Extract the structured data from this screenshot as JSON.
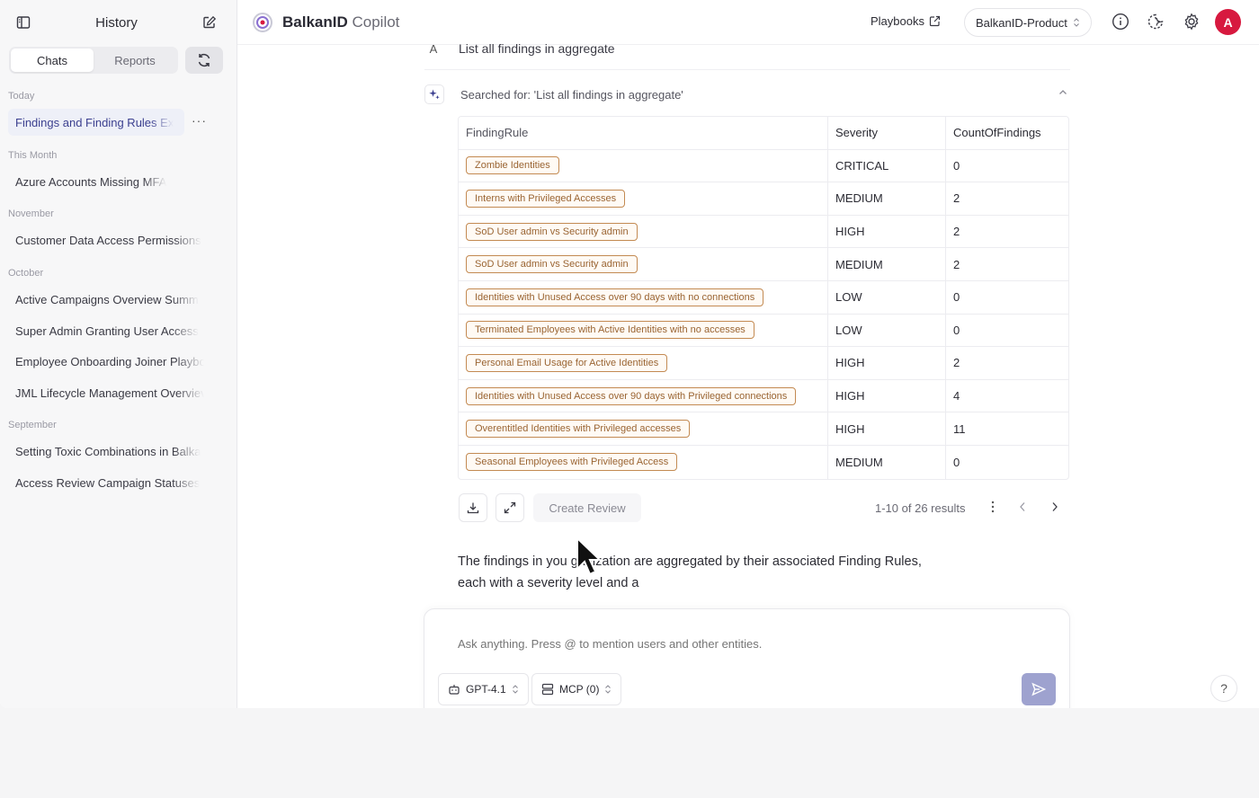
{
  "sidebar": {
    "title": "History",
    "tabs": [
      "Chats",
      "Reports"
    ],
    "groups": [
      {
        "label": "Today",
        "items": [
          "Findings and Finding Rules Ex"
        ]
      },
      {
        "label": "This Month",
        "items": [
          "Azure Accounts Missing MFA"
        ]
      },
      {
        "label": "November",
        "items": [
          "Customer Data Access Permissions"
        ]
      },
      {
        "label": "October",
        "items": [
          "Active Campaigns Overview Summ",
          "Super Admin Granting User Access",
          "Employee Onboarding Joiner Playbo",
          "JML Lifecycle Management Overviev"
        ]
      },
      {
        "label": "September",
        "items": [
          "Setting Toxic Combinations in Balka",
          "Access Review Campaign Statuses"
        ]
      }
    ],
    "more": "···"
  },
  "header": {
    "brand": "BalkanID",
    "brand_suffix": "Copilot",
    "playbooks": "Playbooks",
    "tenant": "BalkanID-Product",
    "avatar": "A"
  },
  "conversation": {
    "prev_badge": "A",
    "prev_message": "List all findings in aggregate",
    "searched_for": "Searched for: 'List all findings in aggregate'",
    "table": {
      "columns": [
        "FindingRule",
        "Severity",
        "CountOfFindings"
      ],
      "rows": [
        {
          "rule": "Zombie Identities",
          "severity": "CRITICAL",
          "count": "0"
        },
        {
          "rule": "Interns with Privileged Accesses",
          "severity": "MEDIUM",
          "count": "2"
        },
        {
          "rule": "SoD User admin vs Security admin",
          "severity": "HIGH",
          "count": "2"
        },
        {
          "rule": "SoD User admin vs Security admin",
          "severity": "MEDIUM",
          "count": "2"
        },
        {
          "rule": "Identities with Unused Access over 90 days with no connections",
          "severity": "LOW",
          "count": "0"
        },
        {
          "rule": "Terminated Employees with Active Identities with no accesses",
          "severity": "LOW",
          "count": "0"
        },
        {
          "rule": "Personal Email Usage for Active Identities",
          "severity": "HIGH",
          "count": "2"
        },
        {
          "rule": "Identities with Unused Access over 90 days with Privileged connections",
          "severity": "HIGH",
          "count": "4"
        },
        {
          "rule": "Overentitled Identities with Privileged accesses",
          "severity": "HIGH",
          "count": "11"
        },
        {
          "rule": "Seasonal Employees with Privileged Access",
          "severity": "MEDIUM",
          "count": "0"
        }
      ]
    },
    "create_review": "Create Review",
    "pagination": "1-10 of 26 results",
    "answer_line1": "The findings in you   ganization are aggregated by their associated Finding Rules,",
    "answer_line2": "each with a severity level and a"
  },
  "composer": {
    "placeholder": "Ask anything. Press @ to mention users and other entities.",
    "model": "GPT-4.1",
    "mcp": "MCP (0)"
  },
  "help": "?",
  "colors": {
    "accent": "#3b3f8f",
    "avatar": "#d7193f",
    "tag_border": "#c38a52",
    "send": "#9ea2cf"
  }
}
